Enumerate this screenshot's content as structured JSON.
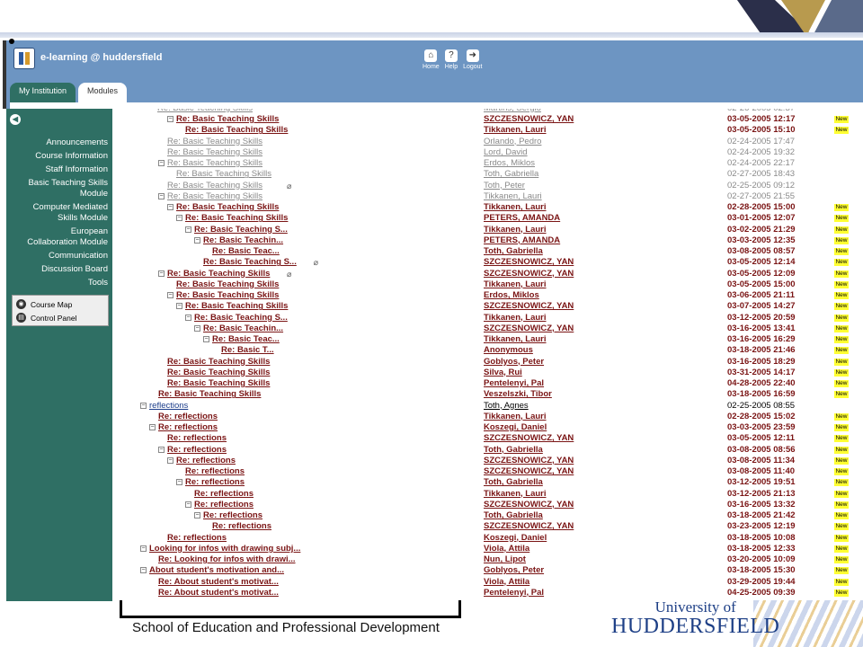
{
  "header": {
    "site_title": "e-learning @ huddersfield",
    "nav": [
      {
        "label": "Home",
        "icon": "home-icon"
      },
      {
        "label": "Help",
        "icon": "help-icon"
      },
      {
        "label": "Logout",
        "icon": "logout-icon"
      }
    ],
    "tabs": [
      {
        "label": "My Institution",
        "active": false
      },
      {
        "label": "Modules",
        "active": true
      }
    ]
  },
  "sidebar": {
    "items": [
      "Announcements",
      "Course Information",
      "Staff Information",
      "Basic Teaching Skills",
      "Module",
      "Computer Mediated",
      "Skills Module",
      "European",
      "Collaboration Module",
      "Communication",
      "Discussion Board",
      "Tools"
    ],
    "tools": [
      {
        "label": "Course Map",
        "icon": "course-map-icon"
      },
      {
        "label": "Control Panel",
        "icon": "control-panel-icon"
      }
    ]
  },
  "threads": [
    {
      "subject": "Re: Basic Teaching Skills",
      "author": "SZCZESNOWICZ, YAN",
      "date": "03-05-2005",
      "time": "12:17",
      "indent": 2,
      "toggle": true,
      "style": "new",
      "new": true
    },
    {
      "subject": "Re: Basic Teaching Skills",
      "author": "Tikkanen, Lauri",
      "date": "03-05-2005",
      "time": "15:10",
      "indent": 3,
      "toggle": false,
      "style": "new",
      "new": true
    },
    {
      "subject": "Re: Basic Teaching Skills",
      "author": "Orlando, Pedro",
      "date": "02-24-2005",
      "time": "17:47",
      "indent": 1,
      "toggle": false,
      "style": "old",
      "new": false
    },
    {
      "subject": "Re: Basic Teaching Skills",
      "author": "Lord, David",
      "date": "02-24-2005",
      "time": "19:32",
      "indent": 1,
      "toggle": false,
      "style": "old",
      "new": false
    },
    {
      "subject": "Re: Basic Teaching Skills",
      "author": "Erdos, Miklos",
      "date": "02-24-2005",
      "time": "22:17",
      "indent": 1,
      "toggle": true,
      "style": "old",
      "new": false
    },
    {
      "subject": "Re: Basic Teaching Skills",
      "author": "Toth, Gabriella",
      "date": "02-27-2005",
      "time": "18:43",
      "indent": 2,
      "toggle": false,
      "style": "old",
      "new": false
    },
    {
      "subject": "Re: Basic Teaching Skills",
      "author": "Toth, Peter",
      "date": "02-25-2005",
      "time": "09:12",
      "indent": 1,
      "toggle": false,
      "style": "old",
      "new": false,
      "clip": true
    },
    {
      "subject": "Re: Basic Teaching Skills",
      "author": "Tikkanen, Lauri",
      "date": "02-27-2005",
      "time": "21:55",
      "indent": 1,
      "toggle": true,
      "style": "old",
      "new": false
    },
    {
      "subject": "Re: Basic Teaching Skills",
      "author": "Tikkanen, Lauri",
      "date": "02-28-2005",
      "time": "15:00",
      "indent": 2,
      "toggle": true,
      "style": "new",
      "new": true
    },
    {
      "subject": "Re: Basic Teaching Skills",
      "author": "PETERS, AMANDA",
      "date": "03-01-2005",
      "time": "12:07",
      "indent": 3,
      "toggle": true,
      "style": "new",
      "new": true
    },
    {
      "subject": "Re: Basic Teaching S...",
      "author": "Tikkanen, Lauri",
      "date": "03-02-2005",
      "time": "21:29",
      "indent": 4,
      "toggle": true,
      "style": "new",
      "new": true
    },
    {
      "subject": "Re: Basic Teachin...",
      "author": "PETERS, AMANDA",
      "date": "03-03-2005",
      "time": "12:35",
      "indent": 5,
      "toggle": true,
      "style": "new",
      "new": true
    },
    {
      "subject": "Re: Basic Teac...",
      "author": "Toth, Gabriella",
      "date": "03-08-2005",
      "time": "08:57",
      "indent": 6,
      "toggle": false,
      "style": "new",
      "new": true
    },
    {
      "subject": "Re: Basic Teaching S...",
      "author": "SZCZESNOWICZ, YAN",
      "date": "03-05-2005",
      "time": "12:14",
      "indent": 5,
      "toggle": false,
      "style": "new",
      "new": true,
      "clip": true
    },
    {
      "subject": "Re: Basic Teaching Skills",
      "author": "SZCZESNOWICZ, YAN",
      "date": "03-05-2005",
      "time": "12:09",
      "indent": 1,
      "toggle": true,
      "style": "new",
      "new": true,
      "clip": true
    },
    {
      "subject": "Re: Basic Teaching Skills",
      "author": "Tikkanen, Lauri",
      "date": "03-05-2005",
      "time": "15:00",
      "indent": 2,
      "toggle": false,
      "style": "new",
      "new": true
    },
    {
      "subject": "Re: Basic Teaching Skills",
      "author": "Erdos, Miklos",
      "date": "03-06-2005",
      "time": "21:11",
      "indent": 2,
      "toggle": true,
      "style": "new",
      "new": true
    },
    {
      "subject": "Re: Basic Teaching Skills",
      "author": "SZCZESNOWICZ, YAN",
      "date": "03-07-2005",
      "time": "14:27",
      "indent": 3,
      "toggle": true,
      "style": "new",
      "new": true
    },
    {
      "subject": "Re: Basic Teaching S...",
      "author": "Tikkanen, Lauri",
      "date": "03-12-2005",
      "time": "20:59",
      "indent": 4,
      "toggle": true,
      "style": "new",
      "new": true
    },
    {
      "subject": "Re: Basic Teachin...",
      "author": "SZCZESNOWICZ, YAN",
      "date": "03-16-2005",
      "time": "13:41",
      "indent": 5,
      "toggle": true,
      "style": "new",
      "new": true
    },
    {
      "subject": "Re: Basic Teac...",
      "author": "Tikkanen, Lauri",
      "date": "03-16-2005",
      "time": "16:29",
      "indent": 6,
      "toggle": true,
      "style": "new",
      "new": true
    },
    {
      "subject": "Re: Basic T...",
      "author": "Anonymous",
      "date": "03-18-2005",
      "time": "21:46",
      "indent": 7,
      "toggle": false,
      "style": "new",
      "new": true
    },
    {
      "subject": "Re: Basic Teaching Skills",
      "author": "Goblyos, Peter",
      "date": "03-16-2005",
      "time": "18:29",
      "indent": 1,
      "toggle": false,
      "style": "new",
      "new": true
    },
    {
      "subject": "Re: Basic Teaching Skills",
      "author": "Silva, Rui",
      "date": "03-31-2005",
      "time": "14:17",
      "indent": 1,
      "toggle": false,
      "style": "new",
      "new": true
    },
    {
      "subject": "Re: Basic Teaching Skills",
      "author": "Pentelenyi, Pal",
      "date": "04-28-2005",
      "time": "22:40",
      "indent": 1,
      "toggle": false,
      "style": "new",
      "new": true
    },
    {
      "subject": "Re: Basic Teaching Skills",
      "author": "Veszelszki, Tibor",
      "date": "03-18-2005",
      "time": "16:59",
      "indent": 0,
      "toggle": false,
      "style": "new",
      "new": true
    },
    {
      "subject": "reflections",
      "author": "Toth, Agnes",
      "date": "02-25-2005",
      "time": "08:55",
      "indent": -1,
      "toggle": true,
      "style": "blue",
      "new": false
    },
    {
      "subject": "Re: reflections",
      "author": "Tikkanen, Lauri",
      "date": "02-28-2005",
      "time": "15:02",
      "indent": 0,
      "toggle": false,
      "style": "new",
      "new": true
    },
    {
      "subject": "Re: reflections",
      "author": "Koszegi, Daniel",
      "date": "03-03-2005",
      "time": "23:59",
      "indent": 0,
      "toggle": true,
      "style": "new",
      "new": true
    },
    {
      "subject": "Re: reflections",
      "author": "SZCZESNOWICZ, YAN",
      "date": "03-05-2005",
      "time": "12:11",
      "indent": 1,
      "toggle": false,
      "style": "new",
      "new": true
    },
    {
      "subject": "Re: reflections",
      "author": "Toth, Gabriella",
      "date": "03-08-2005",
      "time": "08:56",
      "indent": 1,
      "toggle": true,
      "style": "new",
      "new": true
    },
    {
      "subject": "Re: reflections",
      "author": "SZCZESNOWICZ, YAN",
      "date": "03-08-2005",
      "time": "11:34",
      "indent": 2,
      "toggle": true,
      "style": "new",
      "new": true
    },
    {
      "subject": "Re: reflections",
      "author": "SZCZESNOWICZ, YAN",
      "date": "03-08-2005",
      "time": "11:40",
      "indent": 3,
      "toggle": false,
      "style": "new",
      "new": true
    },
    {
      "subject": "Re: reflections",
      "author": "Toth, Gabriella",
      "date": "03-12-2005",
      "time": "19:51",
      "indent": 3,
      "toggle": true,
      "style": "new",
      "new": true
    },
    {
      "subject": "Re: reflections",
      "author": "Tikkanen, Lauri",
      "date": "03-12-2005",
      "time": "21:13",
      "indent": 4,
      "toggle": false,
      "style": "new",
      "new": true
    },
    {
      "subject": "Re: reflections",
      "author": "SZCZESNOWICZ, YAN",
      "date": "03-16-2005",
      "time": "13:32",
      "indent": 4,
      "toggle": true,
      "style": "new",
      "new": true
    },
    {
      "subject": "Re: reflections",
      "author": "Toth, Gabriella",
      "date": "03-18-2005",
      "time": "21:42",
      "indent": 5,
      "toggle": true,
      "style": "new",
      "new": true
    },
    {
      "subject": "Re: reflections",
      "author": "SZCZESNOWICZ, YAN",
      "date": "03-23-2005",
      "time": "12:19",
      "indent": 6,
      "toggle": false,
      "style": "new",
      "new": true
    },
    {
      "subject": "Re: reflections",
      "author": "Koszegi, Daniel",
      "date": "03-18-2005",
      "time": "10:08",
      "indent": 1,
      "toggle": false,
      "style": "new",
      "new": true
    },
    {
      "subject": "Looking for infos with drawing subj...",
      "author": "Viola, Attila",
      "date": "03-18-2005",
      "time": "12:33",
      "indent": -1,
      "toggle": true,
      "style": "new",
      "new": true
    },
    {
      "subject": "Re: Looking for infos with drawi...",
      "author": "Nun, Lipot",
      "date": "03-20-2005",
      "time": "10:09",
      "indent": 0,
      "toggle": false,
      "style": "new",
      "new": true
    },
    {
      "subject": "About student's motivation and...",
      "author": "Goblyos, Peter",
      "date": "03-18-2005",
      "time": "15:30",
      "indent": -1,
      "toggle": true,
      "style": "new",
      "new": true
    },
    {
      "subject": "Re: About student's motivat...",
      "author": "Viola, Attila",
      "date": "03-29-2005",
      "time": "19:44",
      "indent": 0,
      "toggle": false,
      "style": "new",
      "new": true
    },
    {
      "subject": "Re: About student's motivat...",
      "author": "Pentelenyi, Pal",
      "date": "04-25-2005",
      "time": "09:39",
      "indent": 0,
      "toggle": false,
      "style": "new",
      "new": true
    }
  ],
  "new_badge_label": "New",
  "footer": {
    "school": "School of Education and Professional Development",
    "university_line1": "University of",
    "university_line2": "HUDDERSFIELD"
  },
  "colors": {
    "header": "#6d95c2",
    "sidebar": "#2f6f64",
    "new_post": "#7a1414",
    "read_post": "#8a8a8a",
    "new_badge": "#ffff33",
    "university": "#1d3f86"
  }
}
